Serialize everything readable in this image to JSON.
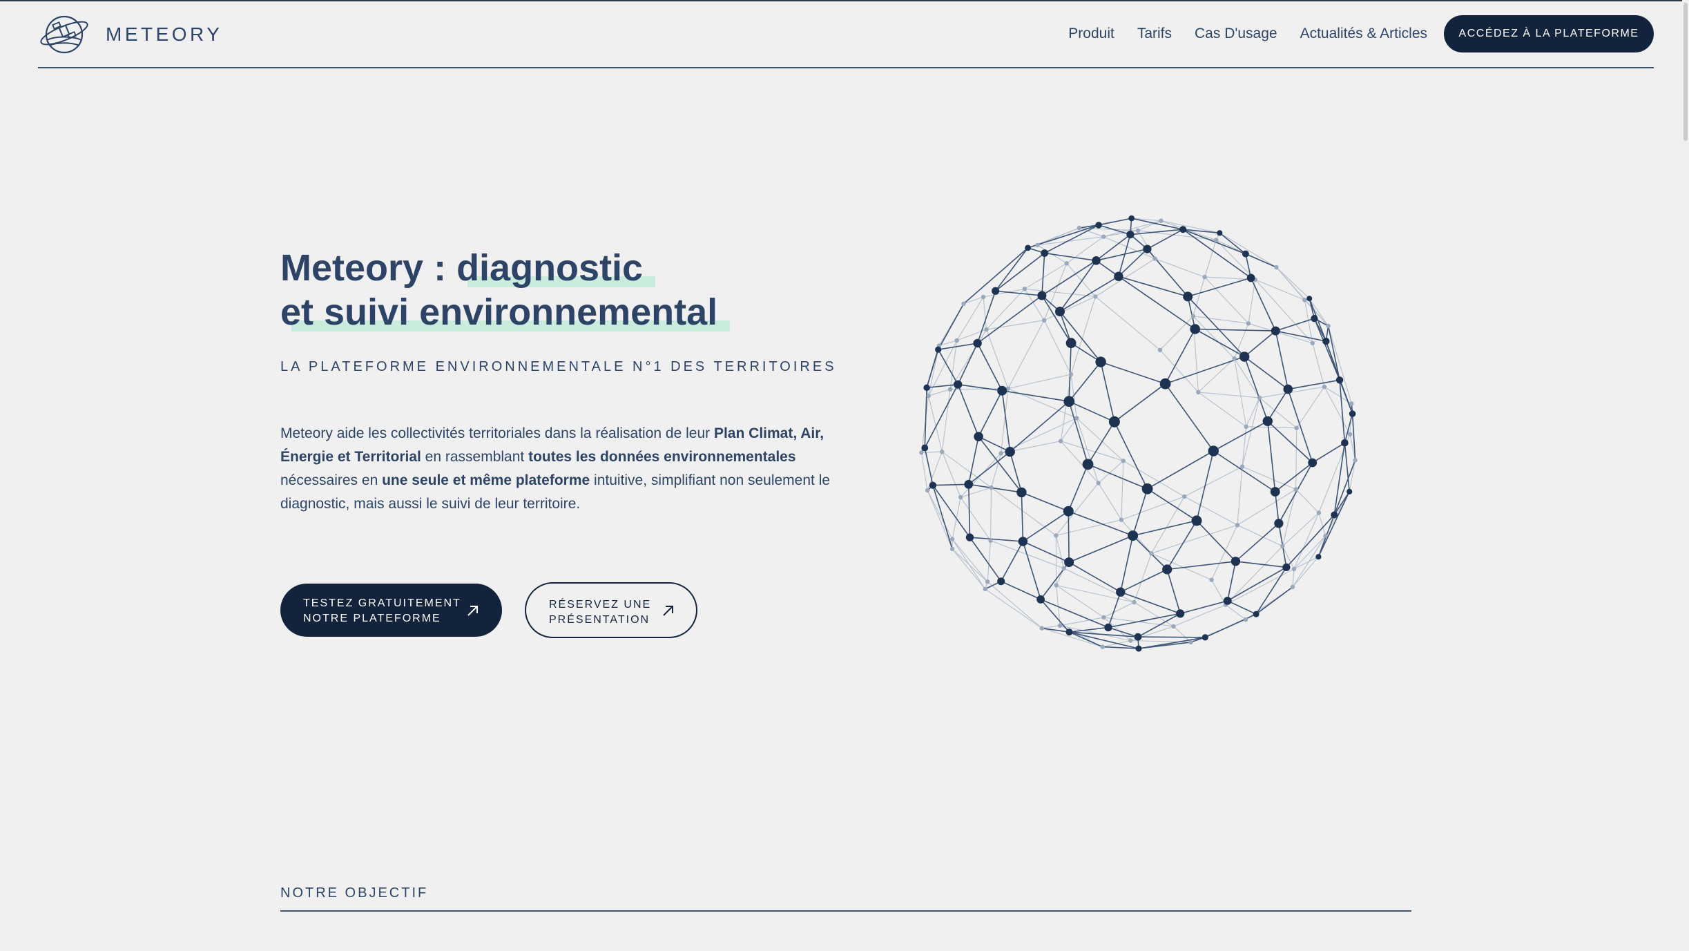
{
  "brand": {
    "name": "METEORY",
    "logo_icon": "satellite-globe-icon"
  },
  "nav": {
    "items": [
      "Produit",
      "Tarifs",
      "Cas D'usage",
      "Actualités & Articles"
    ],
    "cta_label": "ACCÉDEZ À LA PLATEFORME"
  },
  "hero": {
    "title_prefix": "Meteory : ",
    "title_highlight_1": "diagnostic",
    "title_line2": "et suivi environnemental",
    "subtitle": "LA PLATEFORME ENVIRONNEMENTALE N°1 DES TERRITOIRES",
    "description": {
      "p1": "Meteory aide les collectivités territoriales dans la réalisation de leur ",
      "b1": "Plan Climat, Air, Énergie et Territorial",
      "p2": " en rassemblant ",
      "b2": "toutes les données environnementales",
      "p3": " nécessaires en ",
      "b3": "une seule et même plateforme",
      "p4": " intuitive, simplifiant non seulement le diagnostic, mais aussi le suivi de leur territoire."
    },
    "primary_button": {
      "line1": "TESTEZ GRATUITEMENT",
      "line2": "NOTRE PLATEFORME",
      "icon": "arrow-up-right-icon"
    },
    "secondary_button": {
      "line1": "RÉSERVEZ UNE",
      "line2": "PRÉSENTATION",
      "icon": "arrow-up-right-icon"
    },
    "illustration": "wireframe-globe"
  },
  "section": {
    "label": "NOTRE OBJECTIF"
  },
  "colors": {
    "background": "#eff0ef",
    "navy": "#14233c",
    "text": "#2d4466",
    "highlight": "#c9ecdc"
  }
}
